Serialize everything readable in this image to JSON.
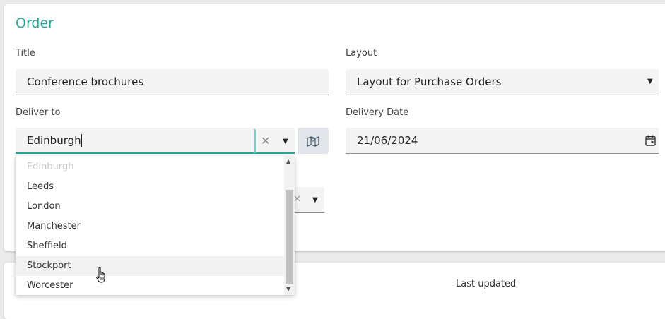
{
  "section": {
    "title": "Order"
  },
  "form": {
    "title_label": "Title",
    "title_value": "Conference brochures",
    "layout_label": "Layout",
    "layout_value": "Layout for Purchase Orders",
    "deliver_label": "Deliver to",
    "deliver_value": "Edinburgh",
    "date_label": "Delivery Date",
    "date_value": "21/06/2024"
  },
  "dropdown": {
    "items": [
      {
        "label": "Edinburgh",
        "state": "disabled"
      },
      {
        "label": "Leeds",
        "state": "normal"
      },
      {
        "label": "London",
        "state": "normal"
      },
      {
        "label": "Manchester",
        "state": "normal"
      },
      {
        "label": "Sheffield",
        "state": "normal"
      },
      {
        "label": "Stockport",
        "state": "hover"
      },
      {
        "label": "Worcester",
        "state": "normal"
      }
    ]
  },
  "footer": {
    "last_updated_label": "Last updated"
  },
  "icons": {
    "clear": "close-icon",
    "dropdown": "caret-down-icon",
    "map": "map-icon",
    "calendar": "calendar-icon",
    "cursor": "hand-pointer-icon"
  },
  "colors": {
    "accent": "#26a69a"
  }
}
